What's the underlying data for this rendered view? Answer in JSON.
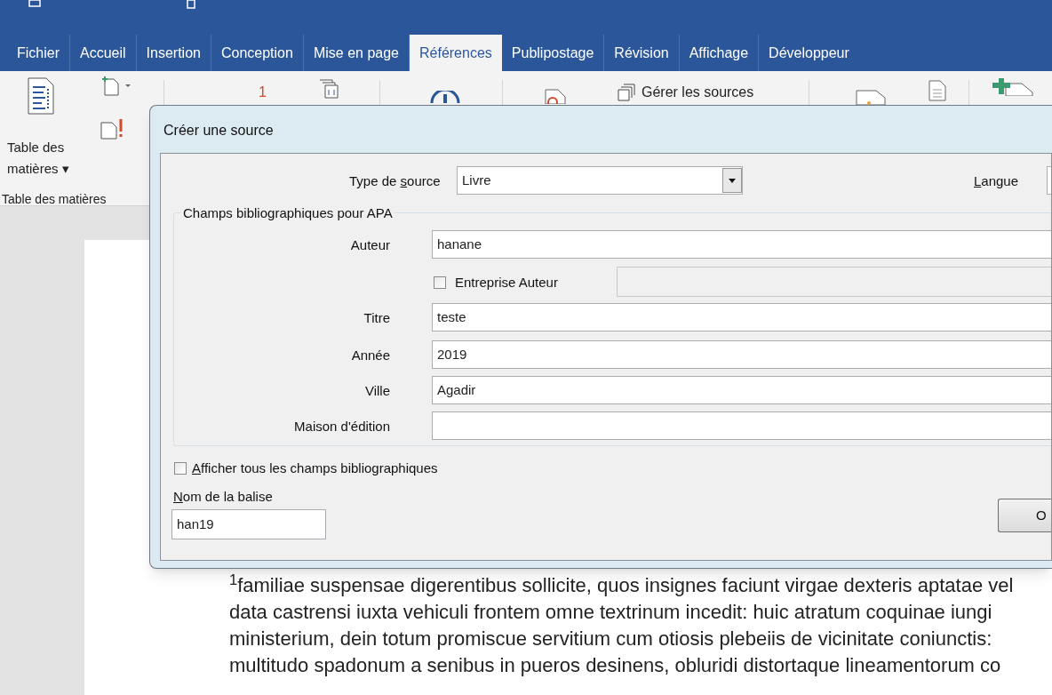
{
  "tabs": [
    {
      "label": "Fichier",
      "selected": false
    },
    {
      "label": "Accueil",
      "selected": false
    },
    {
      "label": "Insertion",
      "selected": false
    },
    {
      "label": "Conception",
      "selected": false
    },
    {
      "label": "Mise en page",
      "selected": false
    },
    {
      "label": "Références",
      "selected": true
    },
    {
      "label": "Publipostage",
      "selected": false
    },
    {
      "label": "Révision",
      "selected": false
    },
    {
      "label": "Affichage",
      "selected": false
    },
    {
      "label": "Développeur",
      "selected": false
    }
  ],
  "ribbon": {
    "toc_button": "Table des matières ▾",
    "group_label": "Table des matières",
    "manage_sources": "Gérer les sources",
    "footnote_mark": "1"
  },
  "dialog": {
    "title": "Créer une source",
    "source_type": {
      "label": {
        "before": "Type de ",
        "key": "s",
        "rest": "ource"
      },
      "value": "Livre"
    },
    "language": {
      "label": {
        "key": "L",
        "rest": "angue"
      }
    },
    "group_title": "Champs bibliographiques pour APA",
    "fields": [
      {
        "kind": "text",
        "label": "Auteur",
        "value": "hanane"
      },
      {
        "kind": "checkbox",
        "label": "Entreprise Auteur",
        "checked": false
      },
      {
        "kind": "text",
        "label": "Titre",
        "value": "teste"
      },
      {
        "kind": "text",
        "label": "Année",
        "value": "2019"
      },
      {
        "kind": "text",
        "label": "Ville",
        "value": "Agadir"
      },
      {
        "kind": "text",
        "label": "Maison d'édition"
      }
    ],
    "show_all": {
      "label": {
        "key": "A",
        "rest": "fficher tous les champs bibliographiques"
      },
      "checked": false
    },
    "tag_name": {
      "label": {
        "key": "N",
        "rest": "om de la balise"
      },
      "value": "han19"
    },
    "ok_button": "O"
  },
  "document_lines": [
    "$^{1}$familiae suspensae digerentibus sollicite, quos insignes faciunt virgae dexteris aptatae vel",
    "data castrensi iuxta vehiculi frontem omne textrinum incedit: huic atratum coquinae iungi",
    "ministerium, dein totum promiscue servitium cum otiosis plebeiis de vicinitate coniunctis:",
    "multitudo spadonum a senibus in pueros desinens, obluridi distortaque lineamentorum co"
  ]
}
